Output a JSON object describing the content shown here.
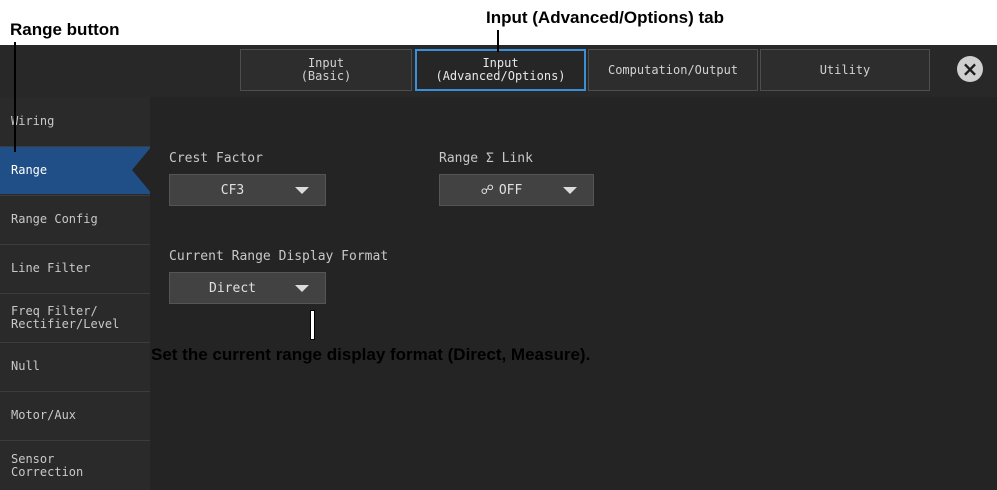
{
  "callouts": {
    "range_button": "Range button",
    "advanced_tab": "Input (Advanced/Options) tab",
    "display_format": "Set the current range display format (Direct, Measure)."
  },
  "tabs": [
    {
      "line1": "Input",
      "line2": "(Basic)"
    },
    {
      "line1": "Input",
      "line2": "(Advanced/Options)"
    },
    {
      "line1": "Computation/Output",
      "line2": ""
    },
    {
      "line1": "Utility",
      "line2": ""
    }
  ],
  "active_tab": 1,
  "close_icon": "×",
  "sidebar": {
    "items": [
      {
        "line1": "Wiring",
        "line2": ""
      },
      {
        "line1": "Range",
        "line2": ""
      },
      {
        "line1": "Range Config",
        "line2": ""
      },
      {
        "line1": "Line Filter",
        "line2": ""
      },
      {
        "line1": "Freq Filter/",
        "line2": "Rectifier/Level"
      },
      {
        "line1": "Null",
        "line2": ""
      },
      {
        "line1": "Motor/Aux",
        "line2": ""
      },
      {
        "line1": "Sensor",
        "line2": "Correction"
      }
    ],
    "active_index": 1
  },
  "settings": {
    "crest_factor": {
      "label": "Crest Factor",
      "value": "CF3"
    },
    "range_link": {
      "label": "Range Σ Link",
      "value": "OFF",
      "icon": "link-off-icon",
      "icon_glyph": "☍"
    },
    "display_format": {
      "label": "Current Range Display Format",
      "value": "Direct"
    }
  },
  "colors": {
    "active_tab_border": "#3a8fd6",
    "active_sidebar": "#1f4f86"
  }
}
